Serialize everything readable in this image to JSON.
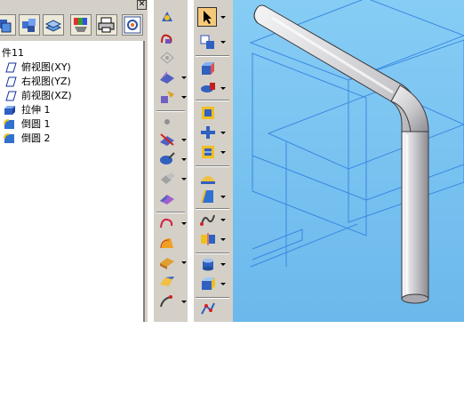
{
  "tree": {
    "part_label": "件11",
    "items": [
      {
        "label": "俯视图(XY)",
        "icon": "plane-icon"
      },
      {
        "label": "右视图(YZ)",
        "icon": "plane-icon"
      },
      {
        "label": "前视图(XZ)",
        "icon": "plane-icon"
      },
      {
        "label": "拉伸 1",
        "icon": "extrude-icon"
      },
      {
        "label": "倒圆 1",
        "icon": "fillet-icon"
      },
      {
        "label": "倒圆 2",
        "icon": "fillet-icon"
      }
    ]
  },
  "panel_toolbar": [
    "layers-icon",
    "parts-icon",
    "sheets-icon",
    "color-icon",
    "print-icon",
    "settings-icon"
  ],
  "close_label": "✕",
  "colors": {
    "viewport_blue": "#7fc6f2",
    "grid_line": "#2f7fe0",
    "toolbar_gray": "#d4d0c8",
    "pipe_gray": "#c8c8cc"
  }
}
